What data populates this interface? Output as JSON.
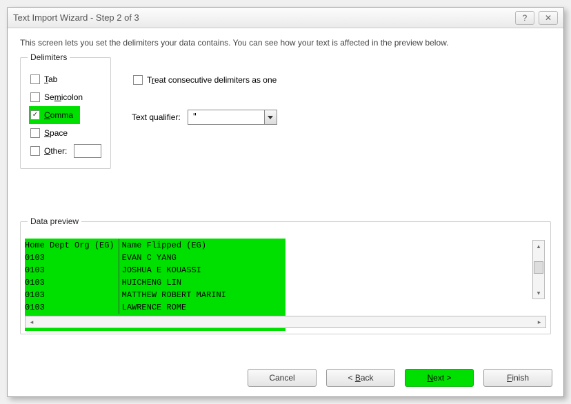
{
  "title": "Text Import Wizard - Step 2 of 3",
  "intro": "This screen lets you set the delimiters your data contains.  You can see how your text is affected in the preview below.",
  "delimiters": {
    "legend": "Delimiters",
    "tab": "Tab",
    "semicolon": "Semicolon",
    "comma": "Comma",
    "space": "Space",
    "other": "Other:"
  },
  "treat_consecutive": "Treat consecutive delimiters as one",
  "text_qualifier_label": "Text qualifier:",
  "text_qualifier_value": "\"",
  "preview": {
    "legend": "Data preview",
    "col1_header": "Home Dept Org (EG)",
    "col2_header": "Name Flipped (EG)",
    "rows": [
      {
        "c1": "0103",
        "c2": "EVAN C YANG"
      },
      {
        "c1": "0103",
        "c2": "JOSHUA E KOUASSI"
      },
      {
        "c1": "0103",
        "c2": "HUICHENG LIN"
      },
      {
        "c1": "0103",
        "c2": "MATTHEW ROBERT MARINI"
      },
      {
        "c1": "0103",
        "c2": "LAWRENCE ROME"
      }
    ]
  },
  "buttons": {
    "cancel": "Cancel",
    "back": "< Back",
    "next": "Next >",
    "finish": "Finish"
  }
}
